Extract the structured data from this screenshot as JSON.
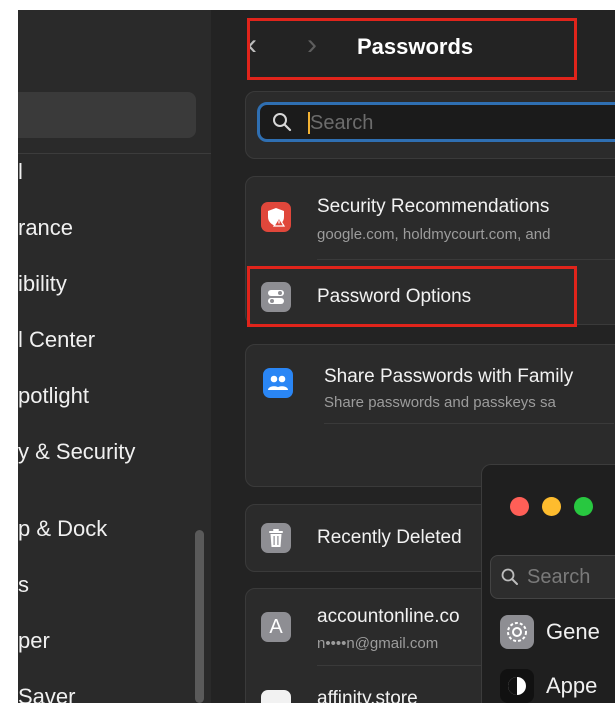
{
  "sidebar": {
    "items": [
      "l",
      "rance",
      "ibility",
      "l Center",
      "potlight",
      "y & Security",
      "p & Dock",
      "s",
      "per",
      "Saver"
    ]
  },
  "toolbar": {
    "back_glyph": "‹",
    "forward_glyph": "›",
    "title": "Passwords"
  },
  "search": {
    "placeholder": "Search"
  },
  "rows": {
    "security": {
      "title": "Security Recommendations",
      "subtitle": "google.com, holdmycourt.com, and"
    },
    "options": {
      "title": "Password Options"
    },
    "share": {
      "title": "Share Passwords with Family",
      "subtitle": "Share passwords and passkeys sa"
    },
    "deleted": {
      "title": "Recently Deleted"
    },
    "account1": {
      "avatar_letter": "A",
      "title": "accountonline.co",
      "subtitle": "n••••n@gmail.com"
    },
    "account2": {
      "title": "affinity.store"
    }
  },
  "overlay_window": {
    "search_placeholder": "Search",
    "items": [
      "Gene",
      "Appe"
    ]
  },
  "colors": {
    "highlight": "#e0241b",
    "search_focus": "#2f6fb2",
    "security_icon": "#e0473b",
    "share_icon": "#2a86f5",
    "traffic_close": "#ff5f57",
    "traffic_min": "#febc2e",
    "traffic_max": "#28c840"
  },
  "icons": {
    "security": "shield-warning-icon",
    "options": "toggle-switches-icon",
    "share": "people-icon",
    "deleted": "trash-icon",
    "general": "gear-icon",
    "appearance": "appearance-icon"
  }
}
